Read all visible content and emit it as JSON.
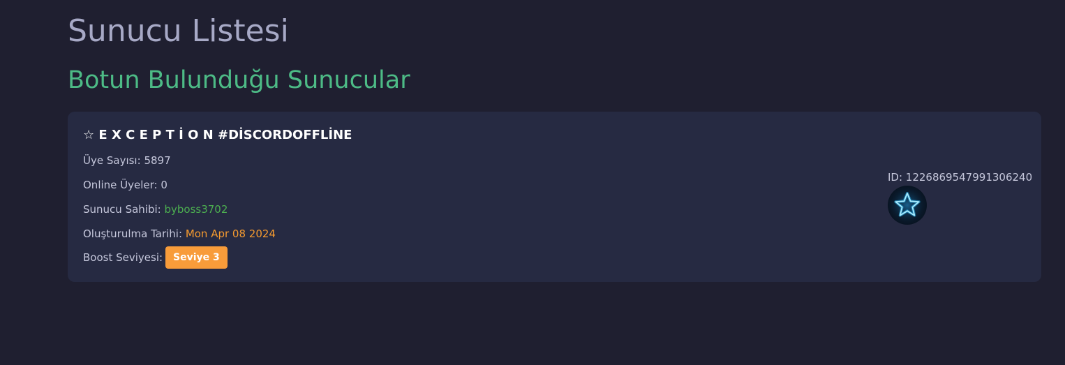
{
  "page": {
    "title": "Sunucu Listesi",
    "section_title": "Botun Bulunduğu Sunucular"
  },
  "server": {
    "name": "☆ E X C E P T İ O N #DİSCORDOFFLİNE",
    "members_label": "Üye Sayısı:",
    "members_value": "5897",
    "online_label": "Online Üyeler:",
    "online_value": "0",
    "owner_label": "Sunucu Sahibi:",
    "owner_value": "byboss3702",
    "created_label": "Oluşturulma Tarihi:",
    "created_value": "Mon Apr 08 2024",
    "boost_label": "Boost Seviyesi:",
    "boost_value": "Seviye 3",
    "id_text": "ID: 1226869547991306240",
    "avatar_icon": "neon-star-icon"
  },
  "colors": {
    "background": "#1f1f30",
    "card": "#262a42",
    "title": "#a7a9c6",
    "section_title": "#4dbb86",
    "owner": "#4caf50",
    "created": "#f59a2f",
    "badge": "#f89c3a",
    "star_glow": "#2ab8f5"
  }
}
